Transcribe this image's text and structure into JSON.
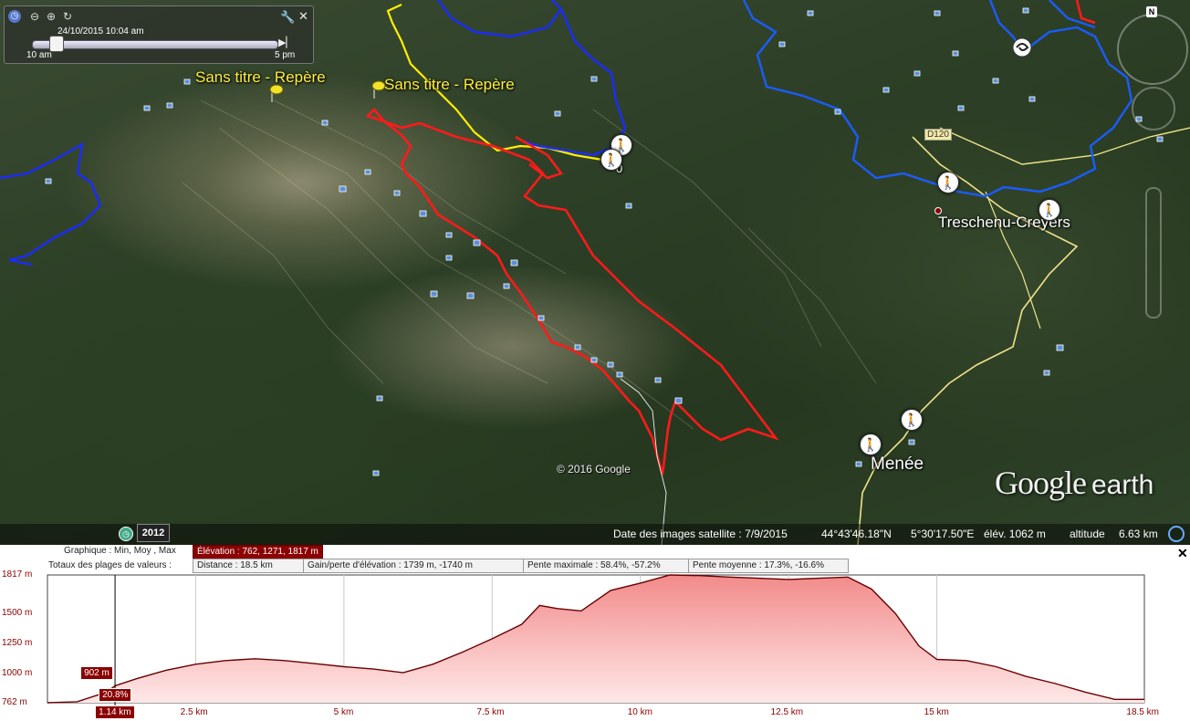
{
  "map": {
    "pins": [
      {
        "label": "Sans titre - Repère"
      },
      {
        "label": "Sans titre - Repère"
      }
    ],
    "places": [
      "Treschenu-Creyers",
      "Menée"
    ],
    "road_label": "D120",
    "waypoint_zero": "0",
    "copyright": "© 2016 Google",
    "logo": {
      "word1": "Google",
      "word2": "earth"
    },
    "status": {
      "year": "2012",
      "imagery_date": "Date des images satellite : 7/9/2015",
      "lat": "44°43'46.18\"N",
      "lon": "5°30'17.50\"E",
      "elev": "élév. 1062 m",
      "altitude_label": "altitude",
      "altitude_value": "6.63 km"
    },
    "track_colors": {
      "red": "#ff1a1a",
      "blue": "#1a2cff",
      "yellow": "#ffee00",
      "road": "#f0e28a"
    }
  },
  "time_slider": {
    "datetime": "24/10/2015  10:04 am",
    "start": "10 am",
    "end": "5 pm",
    "position": 0.07
  },
  "nav": {
    "north": "N"
  },
  "profile": {
    "graph_label": "Graphique : Min, Moy , Max",
    "elevation_summary": "Élévation : 762, 1271, 1817 m",
    "totals_label": "Totaux des plages de valeurs :",
    "distance": "Distance : 18.5 km",
    "gain_loss": "Gain/perte d'élévation : 1739 m, -1740 m",
    "max_slope": "Pente maximale : 58.4%, -57.2%",
    "avg_slope": "Pente moyenne : 17.3%, -16.6%",
    "close": "✕",
    "cursor": {
      "elevation": "902 m",
      "slope": "20.8%",
      "distance": "1.14 km",
      "distance_km": 1.14
    }
  },
  "chart_data": {
    "type": "area",
    "x_unit": "km",
    "y_unit": "m",
    "xlim": [
      0,
      18.5
    ],
    "ylim": [
      762,
      1817
    ],
    "yticks": [
      {
        "value": 1817,
        "label": "1817 m"
      },
      {
        "value": 1500,
        "label": "1500 m"
      },
      {
        "value": 1250,
        "label": "1250 m"
      },
      {
        "value": 1000,
        "label": "1000 m"
      },
      {
        "value": 762,
        "label": "762 m"
      }
    ],
    "xticks": [
      {
        "value": 2.5,
        "label": "2.5 km"
      },
      {
        "value": 5,
        "label": "5 km"
      },
      {
        "value": 7.5,
        "label": "7.5 km"
      },
      {
        "value": 10,
        "label": "10 km"
      },
      {
        "value": 12.5,
        "label": "12.5 km"
      },
      {
        "value": 15,
        "label": "15 km"
      },
      {
        "value": 18.5,
        "label": "18.5 km"
      }
    ],
    "x": [
      0,
      0.5,
      1.0,
      1.14,
      1.5,
      2.0,
      2.5,
      3.0,
      3.5,
      4.0,
      4.5,
      5.0,
      5.5,
      6.0,
      6.5,
      7.0,
      7.5,
      8.0,
      8.3,
      8.6,
      9.0,
      9.5,
      10.0,
      10.5,
      11.0,
      11.5,
      12.0,
      12.5,
      13.0,
      13.5,
      13.9,
      14.3,
      14.7,
      15.0,
      15.5,
      16.0,
      16.5,
      17.0,
      17.5,
      18.0,
      18.5
    ],
    "y": [
      762,
      770,
      850,
      902,
      960,
      1030,
      1080,
      1110,
      1125,
      1110,
      1085,
      1060,
      1040,
      1010,
      1080,
      1180,
      1290,
      1410,
      1565,
      1540,
      1520,
      1690,
      1750,
      1817,
      1812,
      1800,
      1790,
      1780,
      1790,
      1800,
      1700,
      1500,
      1230,
      1120,
      1110,
      1060,
      980,
      920,
      850,
      790,
      790
    ]
  }
}
